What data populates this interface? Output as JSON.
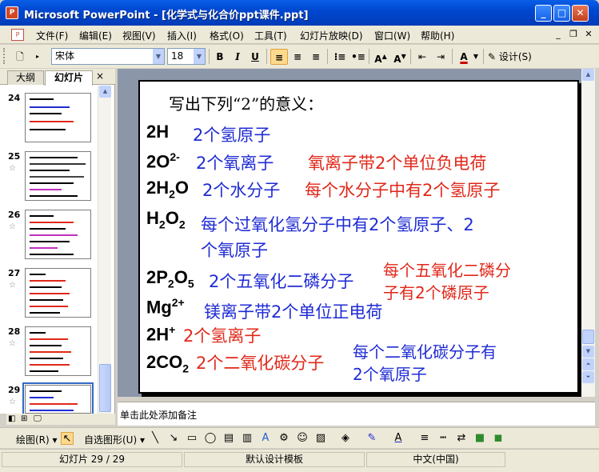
{
  "window": {
    "title": "Microsoft PowerPoint - [化学式与化合价ppt课件.ppt]",
    "app_icon": "powerpoint-icon",
    "controls": [
      "minimize",
      "maximize",
      "close"
    ]
  },
  "menubar": {
    "items": [
      "文件(F)",
      "编辑(E)",
      "视图(V)",
      "插入(I)",
      "格式(O)",
      "工具(T)",
      "幻灯片放映(D)",
      "窗口(W)",
      "帮助(H)"
    ]
  },
  "format_toolbar": {
    "font": "宋体",
    "size": "18",
    "bold": "B",
    "italic": "I",
    "underline": "U",
    "design_label": "设计(S)"
  },
  "left_pane": {
    "tabs": [
      "大纲",
      "幻灯片"
    ],
    "active_tab": "幻灯片",
    "close_label": "×",
    "slides": [
      {
        "number": "24",
        "has_star": false
      },
      {
        "number": "25",
        "has_star": true
      },
      {
        "number": "26",
        "has_star": true
      },
      {
        "number": "27",
        "has_star": true
      },
      {
        "number": "28",
        "has_star": true
      },
      {
        "number": "29",
        "has_star": true
      }
    ],
    "selected_slide": "29"
  },
  "slide": {
    "heading": "写出下列“2”的意义：",
    "lines": {
      "l1": {
        "b": "2个氢原子"
      },
      "l2": {
        "b": "2个氧离子",
        "r": "氧离子带2个单位负电荷"
      },
      "l3": {
        "b": "2个水分子",
        "r": "每个水分子中有2个氢原子"
      },
      "l4": {
        "b1": "每个过氧化氢分子中有2个氢原子、2",
        "b2": "个氧原子"
      },
      "l5": {
        "b": "2个五氧化二磷分子",
        "r1": "每个五氧化二磷分",
        "r2": "子有2个磷原子"
      },
      "l6": {
        "b": "镁离子带2个单位正电荷"
      },
      "l7": {
        "r": "2个氢离子"
      },
      "l8": {
        "r": "2个二氧化碳分子",
        "b1": "每个二氧化碳分子有",
        "b2": "2个氧原子"
      }
    },
    "formulas": {
      "f1": "2H",
      "f2_base": "2O",
      "f2_sup": "2-",
      "f3_a": "2H",
      "f3_sub": "2",
      "f3_b": "O",
      "f4_a": "H",
      "f4_sub1": "2",
      "f4_b": "O",
      "f4_sub2": "2",
      "f5_a": "2P",
      "f5_sub1": "2",
      "f5_b": "O",
      "f5_sub2": "5",
      "f6_base": "Mg",
      "f6_sup": "2+",
      "f7_base": "2H",
      "f7_sup": "+",
      "f8_base": "2CO",
      "f8_sub": "2"
    }
  },
  "notes": {
    "placeholder": "单击此处添加备注"
  },
  "draw_toolbar": {
    "draw_label": "绘图(R)",
    "autoshapes_label": "自选图形(U)"
  },
  "statusbar": {
    "slide_info": "幻灯片 29 / 29",
    "design": "默认设计模板",
    "language": "中文(中国)"
  }
}
